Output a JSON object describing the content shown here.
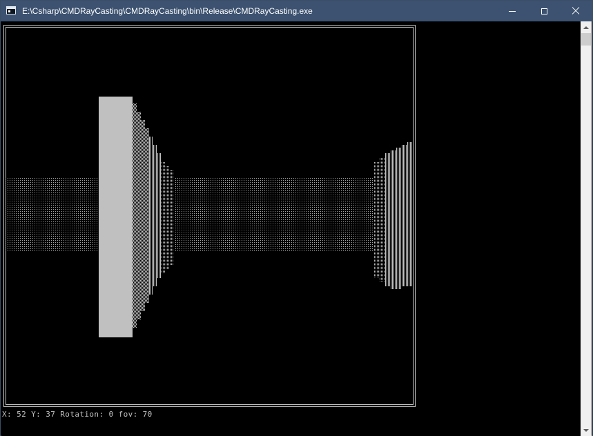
{
  "window": {
    "title": "E:\\Csharp\\CMDRayCasting\\CMDRayCasting\\bin\\Release\\CMDRayCasting.exe",
    "icon": "console-app-icon",
    "controls": {
      "minimize": "minimize-icon",
      "maximize": "maximize-icon",
      "close": "close-icon"
    }
  },
  "console": {
    "status_line": "X: 52 Y: 37 Rotation: 0 fov: 70",
    "colors": {
      "background": "#000000",
      "wall_near": "#c0c0c0",
      "frame": "#c8c8c8",
      "text": "#c0c0c0"
    }
  },
  "scrollbar": {
    "up_icon": "chevron-up-icon",
    "down_icon": "chevron-down-icon"
  }
}
